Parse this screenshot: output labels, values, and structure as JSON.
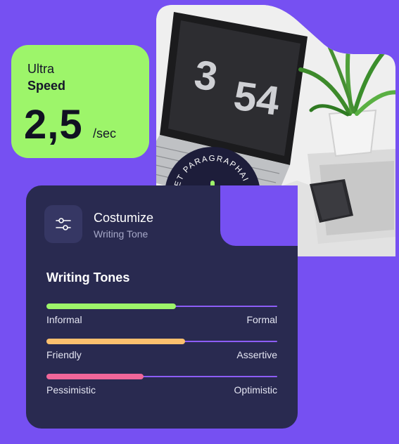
{
  "speed": {
    "line1": "Ultra",
    "line2": "Speed",
    "value": "2,5",
    "unit": "/sec"
  },
  "badge": {
    "text": "GET PARAGRAPHAI • GET PARAGRAPHAI • "
  },
  "photo": {
    "clock_hour": "3",
    "clock_minute": "54"
  },
  "card": {
    "title": "Costumize",
    "subtitle": "Writing Tone",
    "heading": "Writing Tones"
  },
  "tones": [
    {
      "left": "Informal",
      "right": "Formal",
      "level": 0.56,
      "color": "#9df56a"
    },
    {
      "left": "Friendly",
      "right": "Assertive",
      "level": 0.6,
      "color": "#fbc06e"
    },
    {
      "left": "Pessimistic",
      "right": "Optimistic",
      "level": 0.42,
      "color": "#f06699"
    }
  ],
  "colors": {
    "background": "#7650f2",
    "card": "#292a50",
    "speed_card": "#9df56a",
    "track": "#8d5df7"
  }
}
